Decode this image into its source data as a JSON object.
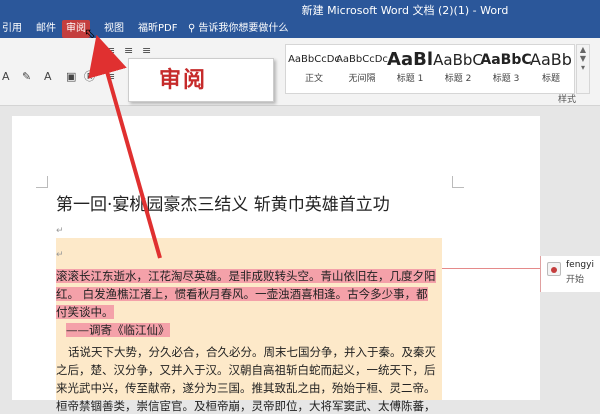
{
  "window": {
    "title": "新建 Microsoft Word 文档 (2)(1) - Word"
  },
  "tabs": [
    {
      "label": "引用"
    },
    {
      "label": "邮件"
    },
    {
      "label": "审阅",
      "active": true
    },
    {
      "label": "视图"
    },
    {
      "label": "福昕PDF"
    }
  ],
  "tellme": {
    "text": "告诉我你想要做什么"
  },
  "styles": {
    "group_label": "样式",
    "items": [
      {
        "sample": "AaBbCcDc",
        "label": "正文"
      },
      {
        "sample": "AaBbCcDc",
        "label": "无间隔"
      },
      {
        "sample": "AaBl",
        "label": "标题 1"
      },
      {
        "sample": "AaBbC",
        "label": "标题 2"
      },
      {
        "sample": "AaBbC",
        "label": "标题 3"
      },
      {
        "sample": "AaBb",
        "label": "标题"
      }
    ]
  },
  "callout": {
    "text": "审阅"
  },
  "document": {
    "title": "第一回·宴桃园豪杰三结义  斩黄巾英雄首立功",
    "lines": [
      "滚滚长江东逝水，江花淘尽英雄。是非成败转头空。青山依旧在，几度夕阳",
      "红。  白发渔樵江渚上，惯看秋月春风。一壶浊酒喜相逢。古今多少事，都",
      "付笑谈中。",
      "——调寄《临江仙》",
      "话说天下大势，分久必合，合久必分。周末七国分争，并入于秦。及秦灭",
      "之后，楚、汉分争，又并入于汉。汉朝自高祖斩白蛇而起义，一统天下，后",
      "来光武中兴，传至献帝，遂分为三国。推其致乱之由，殆始于桓、灵二帝。",
      "桓帝禁锢善类，崇信宦官。及桓帝崩，灵帝即位，大将军窦武、太傅陈蕃，"
    ]
  },
  "comment": {
    "author": "fengyi",
    "action": "开始"
  },
  "colors": {
    "ribbon": "#2b579a",
    "active_tab": "#c43e3e",
    "callout_text": "#c62b2b",
    "highlight": "#f4a1a9",
    "text_block_bg": "#fde9c9"
  }
}
